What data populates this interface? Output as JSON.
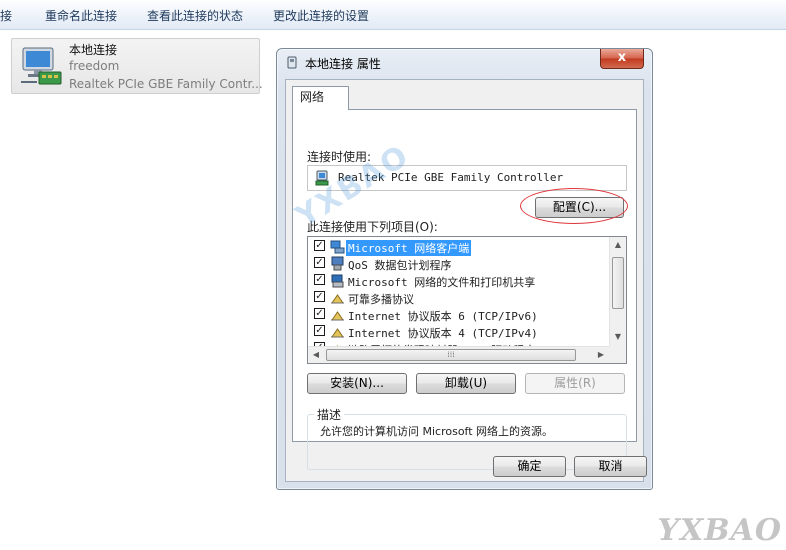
{
  "cmdbar": {
    "items": [
      "接",
      "重命名此连接",
      "查看此连接的状态",
      "更改此连接的设置"
    ]
  },
  "connection": {
    "name": "本地连接",
    "network": "freedom",
    "device": "Realtek PCIe GBE Family Contr..."
  },
  "dialog": {
    "title": "本地连接 属性",
    "close": "x",
    "tab": "网络",
    "connect_using_label": "连接时使用:",
    "adapter": "Realtek PCIe GBE Family Controller",
    "configure_button": "配置(C)...",
    "items_label": "此连接使用下列项目(O):",
    "items": [
      {
        "label": "Microsoft 网络客户端",
        "checked": true,
        "icon": "network-client-icon",
        "selected": true
      },
      {
        "label": "QoS 数据包计划程序",
        "checked": true,
        "icon": "qos-icon",
        "selected": false
      },
      {
        "label": "Microsoft 网络的文件和打印机共享",
        "checked": true,
        "icon": "file-printer-share-icon",
        "selected": false
      },
      {
        "label": "可靠多播协议",
        "checked": true,
        "icon": "protocol-icon",
        "selected": false
      },
      {
        "label": "Internet 协议版本 6 (TCP/IPv6)",
        "checked": true,
        "icon": "protocol-icon",
        "selected": false
      },
      {
        "label": "Internet 协议版本 4 (TCP/IPv4)",
        "checked": true,
        "icon": "protocol-icon",
        "selected": false
      },
      {
        "label": "链路层拓扑发现映射器 I/O 驱动程序",
        "checked": true,
        "icon": "protocol-icon",
        "selected": false
      }
    ],
    "install_button": "安装(N)...",
    "uninstall_button": "卸载(U)",
    "properties_button": "属性(R)",
    "description_label": "描述",
    "description": "允许您的计算机访问 Microsoft 网络上的资源。",
    "ok_button": "确定",
    "cancel_button": "取消"
  },
  "watermark": {
    "brand": "YXBAO",
    "overlay": "YXBAO"
  },
  "colors": {
    "selection": "#3399ff",
    "highlight_ring": "#e0363a",
    "close_button": "#c13a1f"
  }
}
